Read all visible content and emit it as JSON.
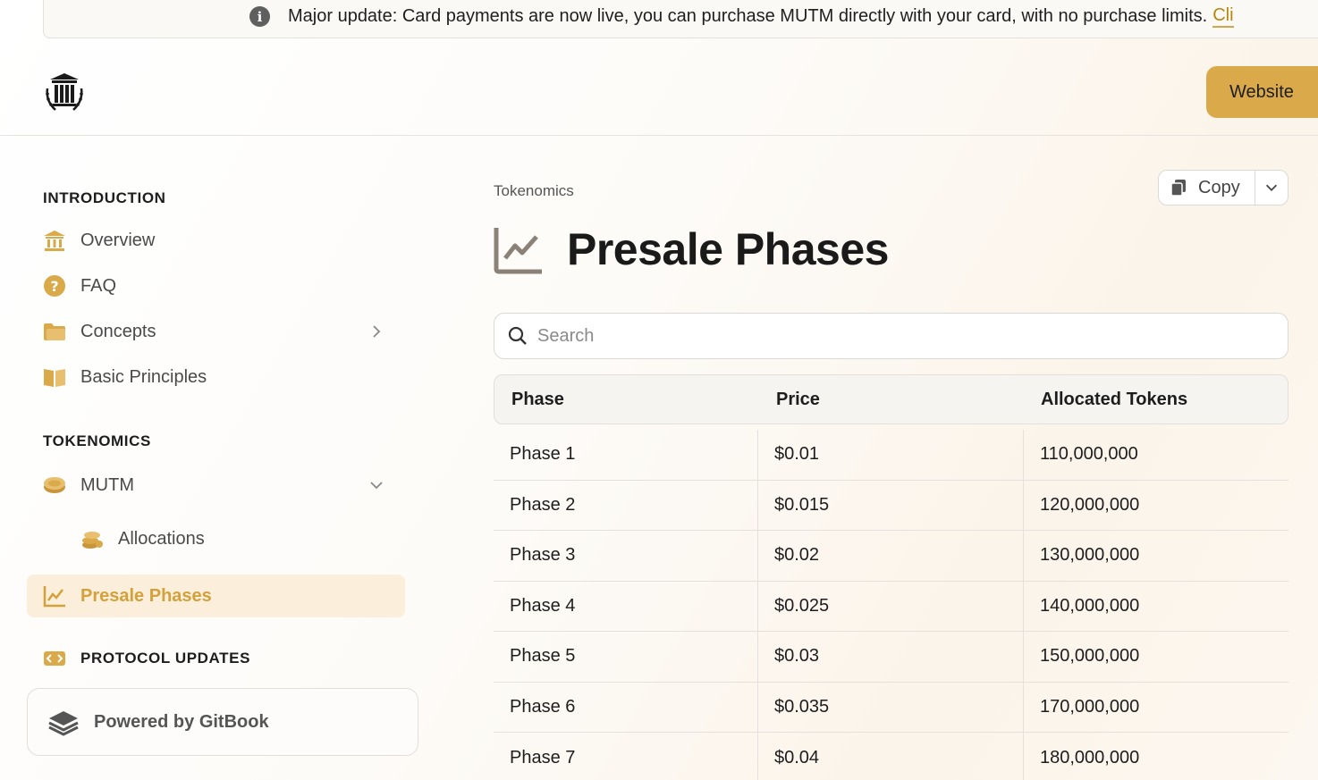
{
  "banner": {
    "message": "Major update: Card payments are now live, you can purchase MUTM directly with your card, with no purchase limits.",
    "link_text": "Cli"
  },
  "header": {
    "logo_icon": "greek-temple-laurel-logo",
    "website_label": "Website"
  },
  "sidebar": {
    "sections": [
      {
        "title": "INTRODUCTION",
        "items": [
          {
            "label": "Overview",
            "icon": "bank-icon"
          },
          {
            "label": "FAQ",
            "icon": "question-icon"
          },
          {
            "label": "Concepts",
            "icon": "folder-icon",
            "chevron": "right"
          },
          {
            "label": "Basic Principles",
            "icon": "book-icon"
          }
        ]
      },
      {
        "title": "TOKENOMICS",
        "items": [
          {
            "label": "MUTM",
            "icon": "coin-icon",
            "chevron": "down"
          },
          {
            "label": "Allocations",
            "icon": "coins-stack-icon"
          },
          {
            "label": "Presale Phases",
            "icon": "chart-line-icon"
          }
        ]
      },
      {
        "title": "PROTOCOL UPDATES",
        "icon": "code-icon"
      }
    ],
    "footer": {
      "label": "Powered by GitBook"
    }
  },
  "main": {
    "breadcrumb": "Tokenomics",
    "copy_label": "Copy",
    "title": "Presale Phases",
    "search_placeholder": "Search",
    "table": {
      "headers": [
        "Phase",
        "Price",
        "Allocated Tokens"
      ],
      "rows": [
        [
          "Phase 1",
          "$0.01",
          "110,000,000"
        ],
        [
          "Phase 2",
          "$0.015",
          "120,000,000"
        ],
        [
          "Phase 3",
          "$0.02",
          "130,000,000"
        ],
        [
          "Phase 4",
          "$0.025",
          "140,000,000"
        ],
        [
          "Phase 5",
          "$0.03",
          "150,000,000"
        ],
        [
          "Phase 6",
          "$0.035",
          "170,000,000"
        ],
        [
          "Phase 7",
          "$0.04",
          "180,000,000"
        ]
      ]
    }
  },
  "colors": {
    "accent": "#d9a94a",
    "active_text": "#d4a03c",
    "active_bg": "#fbefdb"
  }
}
